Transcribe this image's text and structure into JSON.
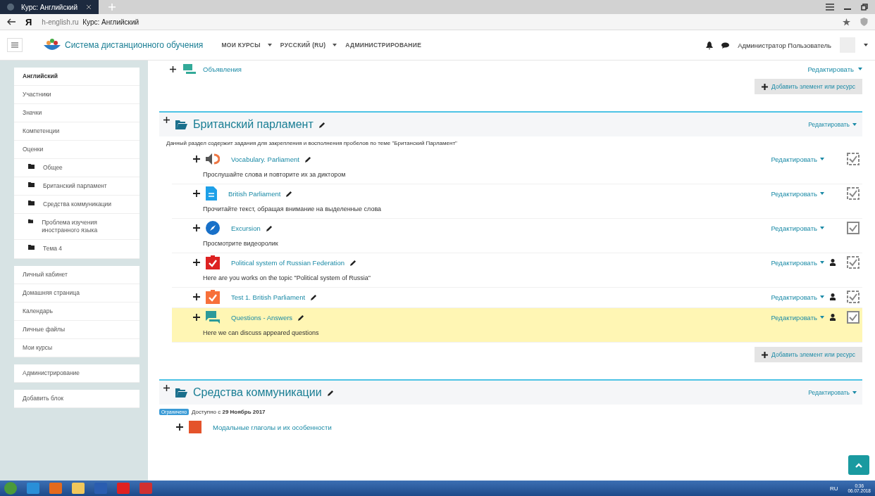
{
  "browser": {
    "logo": "Я",
    "tab_title": "Курс: Английский",
    "url_host": "h-english.ru",
    "url_title": "Курс: Английский"
  },
  "navbar": {
    "brand": "Система дистанционного обучения",
    "menu": [
      {
        "label": "МОИ КУРСЫ",
        "dropdown": true
      },
      {
        "label": "РУССКИЙ (RU)",
        "dropdown": true
      },
      {
        "label": "АДМИНИСТРИРОВАНИЕ",
        "dropdown": false
      }
    ],
    "user": "Администратор Пользователь"
  },
  "sidebar": {
    "blocks": [
      [
        {
          "label": "Английский",
          "selected": true,
          "kind": "link"
        },
        {
          "label": "Участники",
          "selected": false,
          "kind": "link"
        },
        {
          "label": "Значки",
          "selected": false,
          "kind": "link"
        },
        {
          "label": "Компетенции",
          "selected": false,
          "kind": "link"
        },
        {
          "label": "Оценки",
          "selected": false,
          "kind": "link"
        },
        {
          "label": "Общее",
          "selected": false,
          "kind": "folder"
        },
        {
          "label": "Британский парламент",
          "selected": false,
          "kind": "folder"
        },
        {
          "label": "Средства коммуникации",
          "selected": false,
          "kind": "folder"
        },
        {
          "label": "Проблема изучения иностранного языка",
          "selected": false,
          "kind": "folder"
        },
        {
          "label": "Тема 4",
          "selected": false,
          "kind": "folder"
        }
      ],
      [
        {
          "label": "Личный кабинет",
          "selected": false,
          "kind": "link"
        },
        {
          "label": "Домашняя страница",
          "selected": false,
          "kind": "link"
        },
        {
          "label": "Календарь",
          "selected": false,
          "kind": "link"
        },
        {
          "label": "Личные файлы",
          "selected": false,
          "kind": "link"
        },
        {
          "label": "Мои курсы",
          "selected": false,
          "kind": "link"
        }
      ],
      [
        {
          "label": "Администрирование",
          "selected": false,
          "kind": "link"
        }
      ],
      [
        {
          "label": "Добавить блок",
          "selected": false,
          "kind": "link"
        }
      ]
    ]
  },
  "prev_section": {
    "item": {
      "title": "Объявления",
      "edit": "Редактировать"
    },
    "add_button": "Добавить элемент или ресурс"
  },
  "section": {
    "title": "Британский парламент",
    "edit": "Редактировать",
    "summary": "Данный раздел содержит задания для закрепления и восполнения пробелов по теме \"Британский Парламент\"",
    "items": [
      {
        "kind": "audio",
        "title": "Vocabulary. Parliament",
        "description": "Прослушайте слова и повторите их за диктором",
        "edit": "Редактировать",
        "group": false,
        "auto_completion": true,
        "highlighted": false
      },
      {
        "kind": "page",
        "title": "British Parliament",
        "description": "Прочитайте текст, обращая внимание на выделенные слова",
        "edit": "Редактировать",
        "group": false,
        "auto_completion": true,
        "highlighted": false
      },
      {
        "kind": "url",
        "title": "Excursion",
        "description": "Просмотрите видеоролик",
        "edit": "Редактировать",
        "group": false,
        "auto_completion": false,
        "highlighted": false
      },
      {
        "kind": "assign",
        "title": "Political system of Russian Federation",
        "description": "Here are you works on the topic \"Political system of Russia\"",
        "edit": "Редактировать",
        "group": true,
        "auto_completion": true,
        "highlighted": false
      },
      {
        "kind": "quiz",
        "title": "Test 1. British Parliament",
        "edit": "Редактировать",
        "group": true,
        "auto_completion": true,
        "highlighted": false
      },
      {
        "kind": "forum",
        "title": "Questions - Answers",
        "description": "Here we can discuss appeared questions",
        "edit": "Редактировать",
        "group": true,
        "auto_completion": false,
        "highlighted": true
      }
    ],
    "add_button": "Добавить элемент или ресурс"
  },
  "next_section": {
    "title": "Средства коммуникации",
    "edit": "Редактировать",
    "badge": "Ограничено",
    "availability": "Доступно с **29 Ноябрь 2017**",
    "item": "Модальные глаголы и их особенности"
  },
  "taskbar": {
    "lang": "RU",
    "time": "0:36",
    "date": "06.07.2018"
  }
}
